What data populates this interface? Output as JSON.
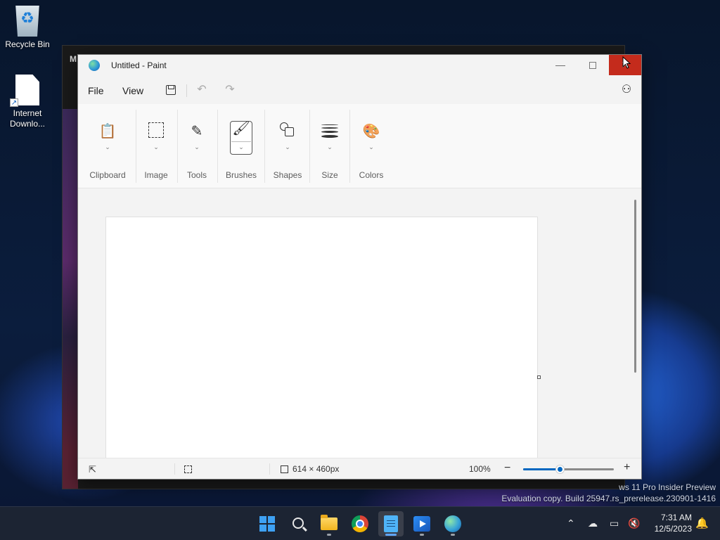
{
  "desktop": {
    "icons": [
      {
        "label": "Recycle Bin"
      },
      {
        "label": "Internet\nDownlo..."
      }
    ],
    "background_window_title": "M",
    "watermark_line1": "ws 11 Pro Insider Preview",
    "watermark_line2": "Evaluation copy. Build 25947.rs_prerelease.230901-1416"
  },
  "paint": {
    "title": "Untitled - Paint",
    "menu": {
      "file": "File",
      "view": "View"
    },
    "ribbon": {
      "groups": [
        {
          "label": "Clipboard",
          "icon": "clipboard-icon"
        },
        {
          "label": "Image",
          "icon": "image-select-icon"
        },
        {
          "label": "Tools",
          "icon": "tools-icon"
        },
        {
          "label": "Brushes",
          "icon": "brush-icon"
        },
        {
          "label": "Shapes",
          "icon": "shapes-icon"
        },
        {
          "label": "Size",
          "icon": "size-icon"
        },
        {
          "label": "Colors",
          "icon": "palette-icon"
        }
      ]
    },
    "status": {
      "canvas_size": "614 × 460px",
      "zoom": "100%",
      "zoom_fraction": 0.4
    }
  },
  "taskbar": {
    "apps": [
      "start",
      "search",
      "file-explorer",
      "chrome",
      "notepad",
      "media-player",
      "paint"
    ],
    "time": "7:31 AM",
    "date": "12/5/2023"
  },
  "colors": {
    "accent": "#0067c0",
    "close_red": "#c42b1c",
    "taskbar": "#1c2433"
  }
}
